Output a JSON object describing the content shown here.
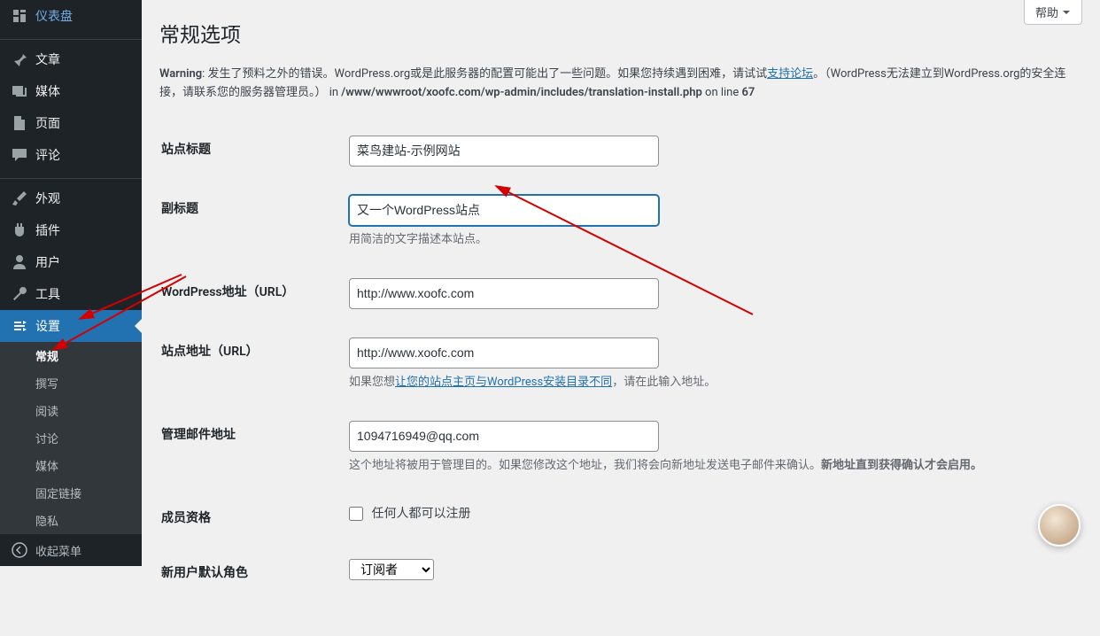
{
  "sidebar": {
    "items": [
      {
        "label": "仪表盘",
        "icon": "dashboard"
      },
      {
        "label": "文章",
        "icon": "pin"
      },
      {
        "label": "媒体",
        "icon": "media"
      },
      {
        "label": "页面",
        "icon": "page"
      },
      {
        "label": "评论",
        "icon": "comment"
      },
      {
        "label": "外观",
        "icon": "brush"
      },
      {
        "label": "插件",
        "icon": "plugin"
      },
      {
        "label": "用户",
        "icon": "user"
      },
      {
        "label": "工具",
        "icon": "wrench"
      },
      {
        "label": "设置",
        "icon": "settings",
        "current": true
      }
    ],
    "settings_submenu": [
      {
        "label": "常规",
        "current": true
      },
      {
        "label": "撰写"
      },
      {
        "label": "阅读"
      },
      {
        "label": "讨论"
      },
      {
        "label": "媒体"
      },
      {
        "label": "固定链接"
      },
      {
        "label": "隐私"
      }
    ],
    "collapse_label": "收起菜单"
  },
  "help_tab": "帮助",
  "page_title": "常规选项",
  "warning": {
    "prefix": "Warning",
    "text1": ": 发生了预料之外的错误。WordPress.org或是此服务器的配置可能出了一些问题。如果您持续遇到困难，请试试",
    "link": "支持论坛",
    "text2": "。（WordPress无法建立到WordPress.org的安全连接，请联系您的服务器管理员。） in ",
    "path": "/www/wwwroot/xoofc.com/wp-admin/includes/translation-install.php",
    "online": " on line ",
    "line": "67"
  },
  "form": {
    "site_title": {
      "label": "站点标题",
      "value": "菜鸟建站-示例网站"
    },
    "tagline": {
      "label": "副标题",
      "value": "又一个WordPress站点",
      "desc": "用简洁的文字描述本站点。"
    },
    "wp_url": {
      "label": "WordPress地址（URL）",
      "value": "http://www.xoofc.com"
    },
    "site_url": {
      "label": "站点地址（URL）",
      "value": "http://www.xoofc.com",
      "desc_pre": "如果您想",
      "desc_link": "让您的站点主页与WordPress安装目录不同",
      "desc_post": "，请在此输入地址。"
    },
    "admin_email": {
      "label": "管理邮件地址",
      "value": "1094716949@qq.com",
      "desc_pre": "这个地址将被用于管理目的。如果您修改这个地址，我们将会向新地址发送电子邮件来确认。",
      "desc_bold": "新地址直到获得确认才会启用。"
    },
    "membership": {
      "label": "成员资格",
      "checkbox_label": "任何人都可以注册"
    },
    "default_role": {
      "label": "新用户默认角色",
      "value": "订阅者"
    }
  }
}
